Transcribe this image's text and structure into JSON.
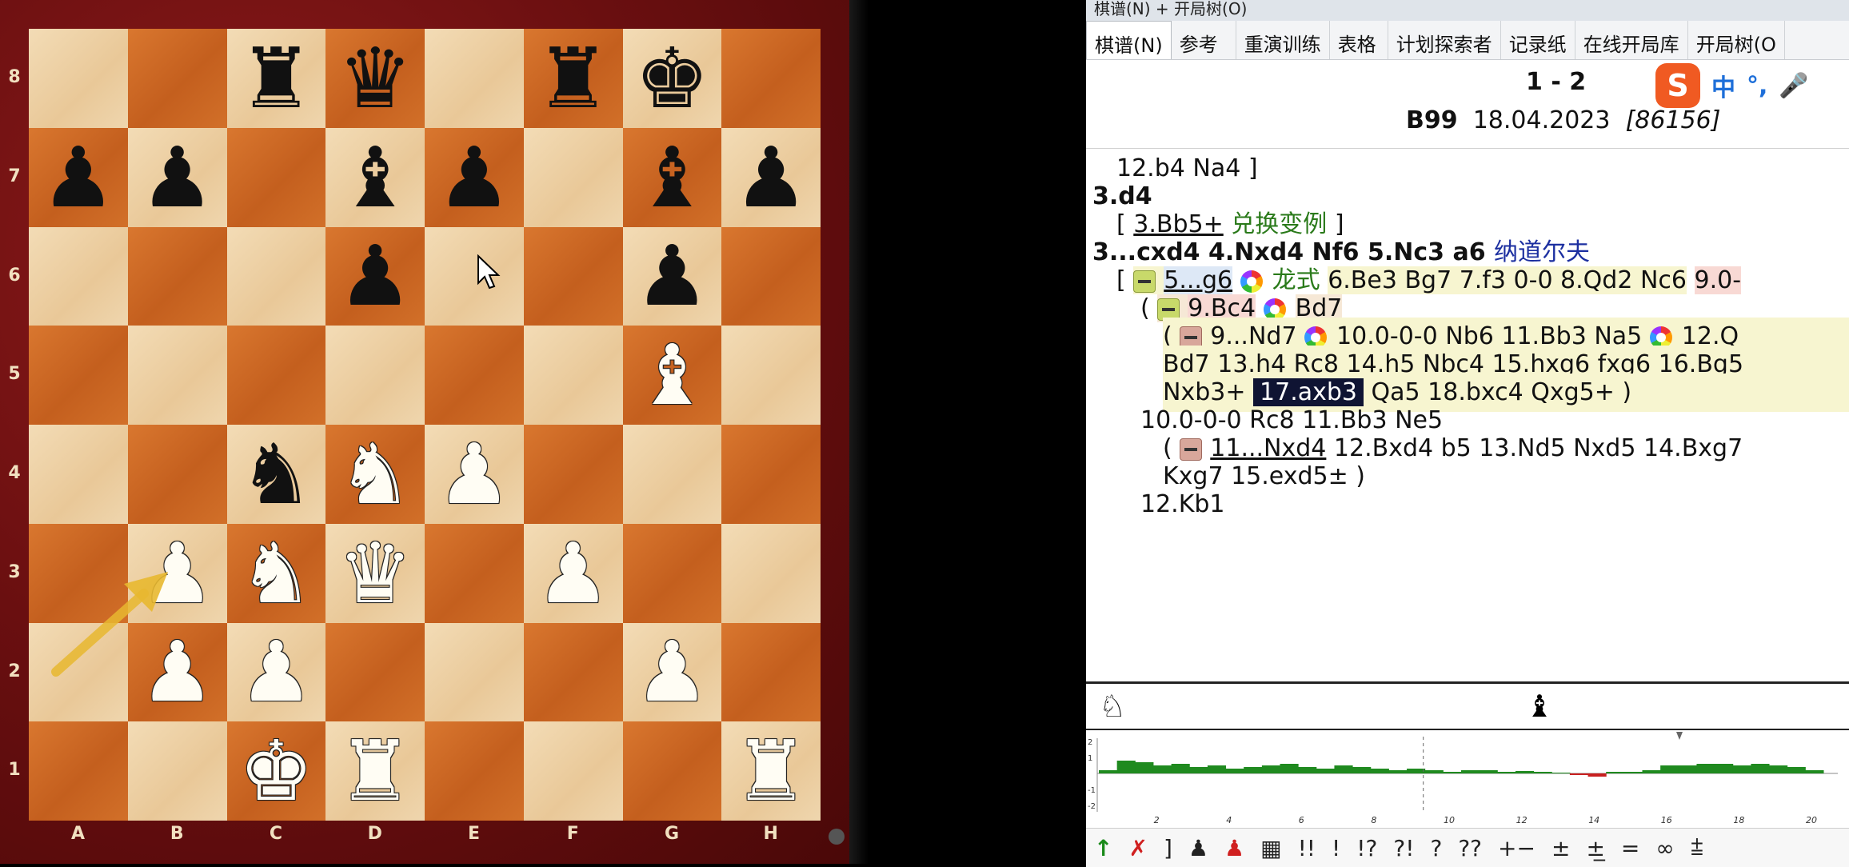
{
  "board": {
    "files": [
      "A",
      "B",
      "C",
      "D",
      "E",
      "F",
      "G",
      "H"
    ],
    "ranks": [
      "8",
      "7",
      "6",
      "5",
      "4",
      "3",
      "2",
      "1"
    ],
    "position": [
      [
        "",
        "",
        "bR",
        "bQ",
        "",
        "bR",
        "bK",
        ""
      ],
      [
        "bP",
        "bP",
        "",
        "bB",
        "bP",
        "",
        "bB",
        "bP"
      ],
      [
        "",
        "",
        "",
        "bP",
        "",
        "",
        "bP",
        ""
      ],
      [
        "",
        "",
        "",
        "",
        "",
        "",
        "wB",
        ""
      ],
      [
        "",
        "",
        "bN",
        "wN",
        "wP",
        "",
        "",
        ""
      ],
      [
        "",
        "wP",
        "wN",
        "wQ",
        "",
        "wP",
        "",
        ""
      ],
      [
        "",
        "wP",
        "wP",
        "",
        "",
        "",
        "wP",
        ""
      ],
      [
        "",
        "",
        "wK",
        "wR",
        "",
        "",
        "",
        "wR"
      ]
    ],
    "last_move_arrow": "a2-b3",
    "colors": {
      "light": "#efd6ae",
      "dark": "#c9651f",
      "frame": "#6a0f10",
      "arrow": "#e8b830"
    }
  },
  "window": {
    "title": "棋谱(N) + 开局树(O)"
  },
  "tabs": [
    "棋谱(N)",
    "参考",
    "重演训练",
    "表格",
    "计划探索者",
    "记录纸",
    "在线开局库",
    "开局树(O"
  ],
  "game": {
    "score": "1 - 2",
    "eco": "B99",
    "date": "18.04.2023",
    "game_id": "[86156]"
  },
  "ime": {
    "logo": "S",
    "mode": "中",
    "punct": "°,",
    "mic": "🎤"
  },
  "notation": {
    "l1": "12.b4  Na4 ]",
    "l2": "3.d4",
    "l3_open": "[",
    "l3_move": "3.Bb5+",
    "l3_name": "兑换变例",
    "l3_close": "]",
    "l4_moves": "3...cxd4  4.Nxd4  Nf6  5.Nc3  a6",
    "l4_name": "纳道尔夫",
    "l5_open": "[",
    "l5_move": "5...g6",
    "l5_name": "龙式",
    "l5_rest": "6.Be3  Bg7  7.f3  0-0  8.Qd2  Nc6",
    "l5_tail": "9.0-",
    "l6_open": "(",
    "l6_move": "9.Bc4",
    "l6_rest": "Bd7",
    "l7_open": "(",
    "l7_move": "9...Nd7",
    "l7_rest": "10.0-0-0  Nb6  11.Bb3  Na5",
    "l7_tail": "12.Q",
    "l8": "Bd7  13.h4  Rc8  14.h5  Nbc4  15.hxg6  fxg6  16.Bg5",
    "l9_pre": "Nxb3+",
    "l9_sel": "17.axb3",
    "l9_post": "Qa5  18.bxc4  Qxg5+ )",
    "l10": "10.0-0-0  Rc8  11.Bb3  Ne5",
    "l11_open": "(",
    "l11_move": "11...Nxd4",
    "l11_rest": "12.Bxd4  b5  13.Nd5  Nxd5  14.Bxg7",
    "l12": "Kxg7  15.exd5± )",
    "l13": "12.Kb1"
  },
  "eval_graph": {
    "y_ticks": [
      "2",
      "1",
      "-1",
      "-2"
    ],
    "x_ticks": [
      "2",
      "4",
      "6",
      "8",
      "10",
      "12",
      "14",
      "16",
      "18",
      "20"
    ],
    "values": [
      0.2,
      0.8,
      0.7,
      0.5,
      0.6,
      0.4,
      0.5,
      0.3,
      0.4,
      0.5,
      0.6,
      0.4,
      0.3,
      0.5,
      0.4,
      0.3,
      0.2,
      0.3,
      0.2,
      0.1,
      0.2,
      0.2,
      0.1,
      0.15,
      0.1,
      0.05,
      -0.1,
      -0.2,
      0.1,
      0.1,
      0.2,
      0.5,
      0.5,
      0.6,
      0.6,
      0.5,
      0.6,
      0.5,
      0.4,
      0.2
    ],
    "markers": [
      "♘",
      "♝"
    ]
  },
  "symbols": [
    "↑",
    "✗",
    "]",
    "♟",
    "♟",
    "▦",
    "!!",
    "!",
    "!?",
    "?!",
    "?",
    "??",
    "+−",
    "±",
    "±̲",
    "=",
    "∞",
    "⩲"
  ]
}
